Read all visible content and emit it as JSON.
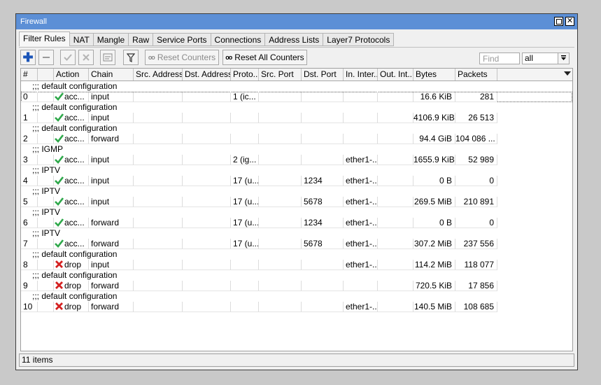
{
  "window": {
    "title": "Firewall"
  },
  "tabs": [
    {
      "label": "Filter Rules",
      "active": true
    },
    {
      "label": "NAT"
    },
    {
      "label": "Mangle"
    },
    {
      "label": "Raw"
    },
    {
      "label": "Service Ports"
    },
    {
      "label": "Connections"
    },
    {
      "label": "Address Lists"
    },
    {
      "label": "Layer7 Protocols"
    }
  ],
  "toolbar": {
    "add_icon": "plus-icon",
    "remove_icon": "minus-icon",
    "enable_icon": "check-icon",
    "disable_icon": "x-icon",
    "comment_icon": "note-icon",
    "filter_icon": "funnel-icon",
    "reset_counters_label": "Reset Counters",
    "reset_all_counters_label": "Reset All Counters",
    "find_placeholder": "Find",
    "find_value": "",
    "scope_value": "all"
  },
  "columns": [
    "#",
    "",
    "Action",
    "Chain",
    "Src. Address",
    "Dst. Address",
    "Proto...",
    "Src. Port",
    "Dst. Port",
    "In. Inter...",
    "Out. Int...",
    "Bytes",
    "Packets"
  ],
  "rules": [
    {
      "comment": ";;; default configuration",
      "num": "0",
      "action": "acc...",
      "action_type": "accept",
      "chain": "input",
      "proto": "1 (ic...",
      "dst_port": "",
      "in_iface": "",
      "bytes": "16.6 KiB",
      "packets": "281"
    },
    {
      "comment": ";;; default configuration",
      "num": "1",
      "action": "acc...",
      "action_type": "accept",
      "chain": "input",
      "proto": "",
      "dst_port": "",
      "in_iface": "",
      "bytes": "4106.9 KiB",
      "packets": "26 513"
    },
    {
      "comment": ";;; default configuration",
      "num": "2",
      "action": "acc...",
      "action_type": "accept",
      "chain": "forward",
      "proto": "",
      "dst_port": "",
      "in_iface": "",
      "bytes": "94.4 GiB",
      "packets": "104 086 ..."
    },
    {
      "comment": ";;; IGMP",
      "num": "3",
      "action": "acc...",
      "action_type": "accept",
      "chain": "input",
      "proto": "2 (ig...",
      "dst_port": "",
      "in_iface": "ether1-...",
      "bytes": "1655.9 KiB",
      "packets": "52 989"
    },
    {
      "comment": ";;; IPTV",
      "num": "4",
      "action": "acc...",
      "action_type": "accept",
      "chain": "input",
      "proto": "17 (u...",
      "dst_port": "1234",
      "in_iface": "ether1-...",
      "bytes": "0 B",
      "packets": "0"
    },
    {
      "comment": ";;; IPTV",
      "num": "5",
      "action": "acc...",
      "action_type": "accept",
      "chain": "input",
      "proto": "17 (u...",
      "dst_port": "5678",
      "in_iface": "ether1-...",
      "bytes": "269.5 MiB",
      "packets": "210 891"
    },
    {
      "comment": ";;; IPTV",
      "num": "6",
      "action": "acc...",
      "action_type": "accept",
      "chain": "forward",
      "proto": "17 (u...",
      "dst_port": "1234",
      "in_iface": "ether1-...",
      "bytes": "0 B",
      "packets": "0"
    },
    {
      "comment": ";;; IPTV",
      "num": "7",
      "action": "acc...",
      "action_type": "accept",
      "chain": "forward",
      "proto": "17 (u...",
      "dst_port": "5678",
      "in_iface": "ether1-...",
      "bytes": "307.2 MiB",
      "packets": "237 556"
    },
    {
      "comment": ";;; default configuration",
      "num": "8",
      "action": "drop",
      "action_type": "drop",
      "chain": "input",
      "proto": "",
      "dst_port": "",
      "in_iface": "ether1-...",
      "bytes": "114.2 MiB",
      "packets": "118 077"
    },
    {
      "comment": ";;; default configuration",
      "num": "9",
      "action": "drop",
      "action_type": "drop",
      "chain": "forward",
      "proto": "",
      "dst_port": "",
      "in_iface": "",
      "bytes": "720.5 KiB",
      "packets": "17 856"
    },
    {
      "comment": ";;; default configuration",
      "num": "10",
      "action": "drop",
      "action_type": "drop",
      "chain": "forward",
      "proto": "",
      "dst_port": "",
      "in_iface": "ether1-...",
      "bytes": "140.5 MiB",
      "packets": "108 685"
    }
  ],
  "status": {
    "items_text": "11 items"
  },
  "colors": {
    "titlebar": "#5c8fd6",
    "accept": "#2ea84a",
    "drop": "#d42020"
  }
}
